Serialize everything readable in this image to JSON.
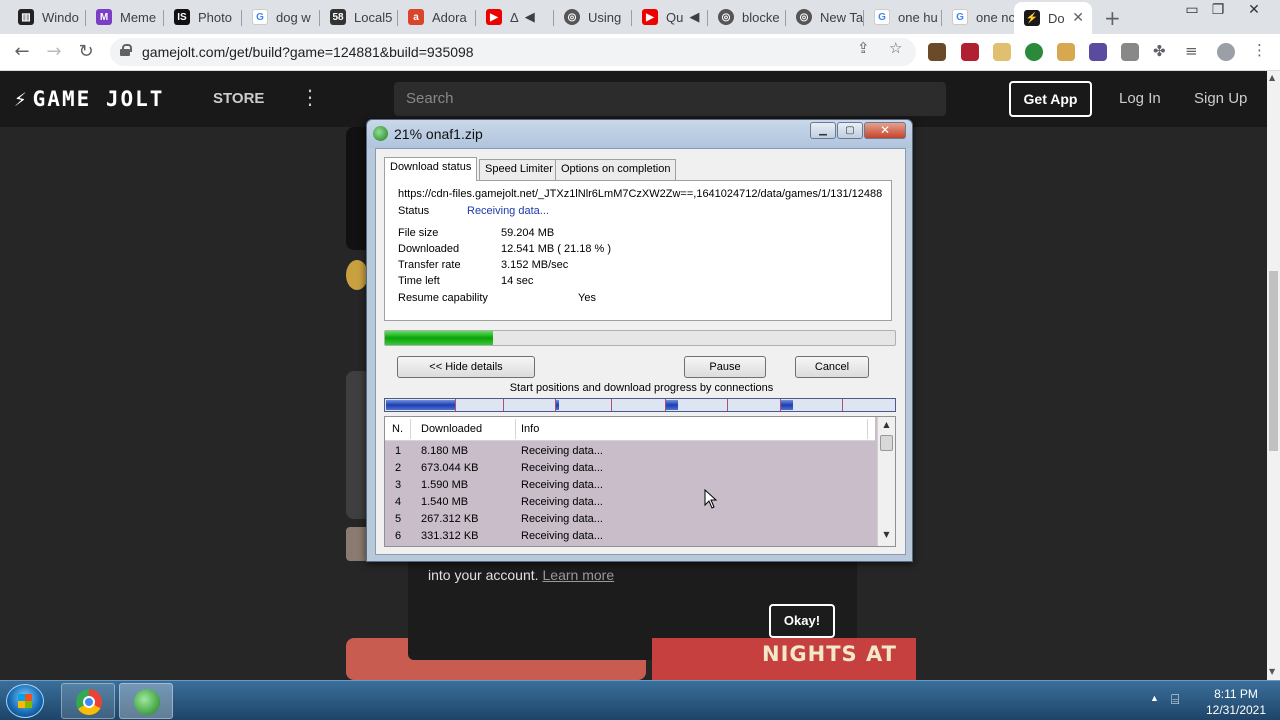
{
  "browser": {
    "tabs": [
      {
        "label": "Windo",
        "color": "#222"
      },
      {
        "label": "Meme",
        "color": "#7a3fc4"
      },
      {
        "label": "Photo",
        "color": "#111"
      },
      {
        "label": "dog w",
        "color": "#4285f4"
      },
      {
        "label": "Local5",
        "color": "#333"
      },
      {
        "label": "Adora",
        "color": "#d9452a"
      },
      {
        "label": "Δ",
        "color": "#e00"
      },
      {
        "label": "Using",
        "color": "#555"
      },
      {
        "label": "Qu",
        "color": "#e00"
      },
      {
        "label": "blocke",
        "color": "#555"
      },
      {
        "label": "New Ta",
        "color": "#555"
      },
      {
        "label": "one hu",
        "color": "#4285f4"
      },
      {
        "label": "one nc",
        "color": "#4285f4"
      },
      {
        "label": "Do",
        "color": "#1a1a1a"
      }
    ],
    "url": "gamejolt.com/get/build?game=124881&build=935098"
  },
  "gamejolt": {
    "logo": "GAME JOLT",
    "store": "STORE",
    "search_placeholder": "Search",
    "get_app": "Get App",
    "login": "Log In",
    "signup": "Sign Up",
    "modal_text": "into your account.",
    "modal_link": "Learn more",
    "okay": "Okay!",
    "banner_text": "NIGHTS AT"
  },
  "idm": {
    "title": "21% onaf1.zip",
    "tabs": [
      "Download status",
      "Speed Limiter",
      "Options on completion"
    ],
    "url": "https://cdn-files.gamejolt.net/_JTXz1lNlr6LmM7CzXW2Zw==,1641024712/data/games/1/131/12488",
    "status_label": "Status",
    "status_value": "Receiving data...",
    "file_size_label": "File size",
    "file_size_value": "59.204  MB",
    "downloaded_label": "Downloaded",
    "downloaded_value": "12.541  MB  ( 21.18 % )",
    "transfer_label": "Transfer rate",
    "transfer_value": "3.152  MB/sec",
    "time_label": "Time left",
    "time_value": "14 sec",
    "resume_label": "Resume capability",
    "resume_value": "Yes",
    "progress_fraction": 0.2118,
    "hide_details": "<< Hide details",
    "pause": "Pause",
    "cancel": "Cancel",
    "connections_label": "Start positions and download progress by connections",
    "columns": [
      "N.",
      "Downloaded",
      "Info"
    ],
    "rows": [
      {
        "n": "1",
        "downloaded": "8.180  MB",
        "info": "Receiving data..."
      },
      {
        "n": "2",
        "downloaded": "673.044  KB",
        "info": "Receiving data..."
      },
      {
        "n": "3",
        "downloaded": "1.590  MB",
        "info": "Receiving data..."
      },
      {
        "n": "4",
        "downloaded": "1.540  MB",
        "info": "Receiving data..."
      },
      {
        "n": "5",
        "downloaded": "267.312  KB",
        "info": "Receiving data..."
      },
      {
        "n": "6",
        "downloaded": "331.312  KB",
        "info": "Receiving data..."
      }
    ]
  },
  "taskbar": {
    "time": "8:11 PM",
    "date": "12/31/2021"
  }
}
